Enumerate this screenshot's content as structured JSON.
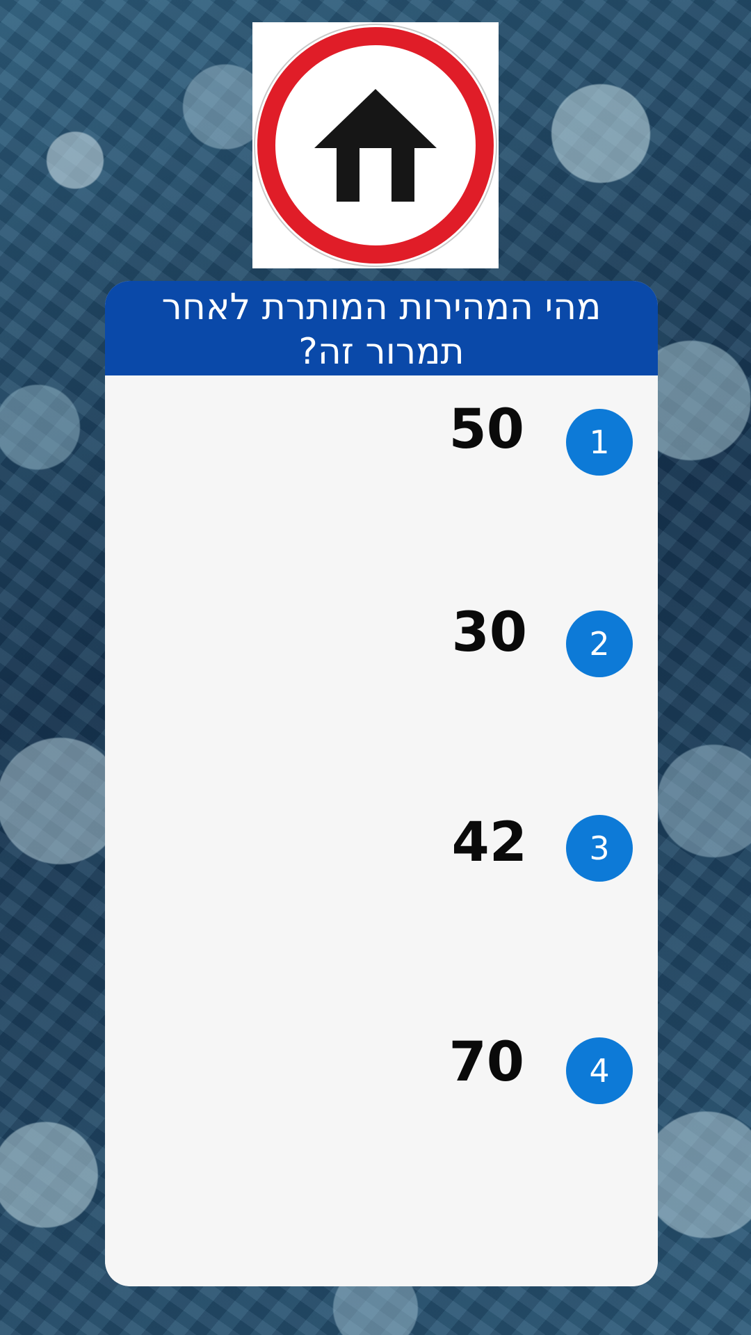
{
  "sign": {
    "icon": "no-entry-except-local-traffic-sign-icon",
    "ring_color": "#e01d28",
    "symbol_color": "#161616"
  },
  "question": {
    "text": "מהי המהירות המותרת לאחר תמרור זה?",
    "bar_color": "#0a49a9"
  },
  "answers": [
    {
      "index": "1",
      "value": "50"
    },
    {
      "index": "2",
      "value": "30"
    },
    {
      "index": "3",
      "value": "42"
    },
    {
      "index": "4",
      "value": "70"
    }
  ],
  "colors": {
    "badge": "#0d7ad7",
    "panel": "#f6f6f6"
  }
}
